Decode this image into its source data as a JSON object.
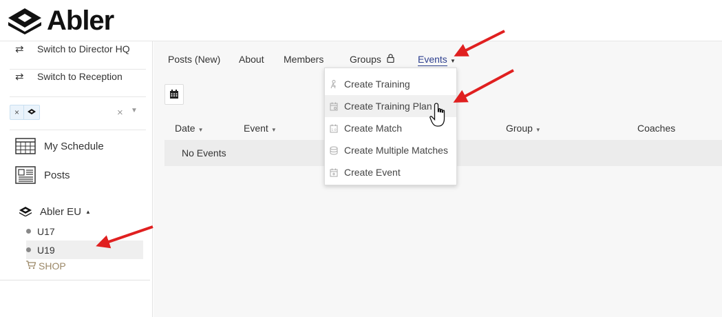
{
  "brand": {
    "name": "Abler"
  },
  "sidebar": {
    "switches": [
      {
        "label": "Switch to Director HQ"
      },
      {
        "label": "Switch to Reception"
      }
    ],
    "filter": {
      "chip_remove": "×",
      "clear": "×"
    },
    "nav": [
      {
        "label": "My Schedule",
        "icon": "calendar-grid-icon"
      },
      {
        "label": "Posts",
        "icon": "newspaper-icon"
      }
    ],
    "org": {
      "label": "Abler EU",
      "expanded": true
    },
    "teams": [
      {
        "label": "U17",
        "active": false
      },
      {
        "label": "U19",
        "active": true
      }
    ],
    "shop": {
      "label": "SHOP"
    }
  },
  "main": {
    "tabs": [
      {
        "label": "Posts (New)"
      },
      {
        "label": "About"
      },
      {
        "label": "Members"
      },
      {
        "label": "Groups"
      },
      {
        "label": "Events",
        "active": true
      }
    ],
    "table": {
      "columns": [
        {
          "label": "Date",
          "sortable": true
        },
        {
          "label": "Event",
          "sortable": true
        },
        {
          "label": "Group",
          "sortable": true
        },
        {
          "label": "Coaches",
          "sortable": false
        }
      ],
      "empty_text": "No Events"
    }
  },
  "events_menu": {
    "items": [
      {
        "label": "Create Training",
        "icon": "training-icon"
      },
      {
        "label": "Create Training Plan",
        "icon": "training-plan-icon",
        "hovered": true
      },
      {
        "label": "Create Match",
        "icon": "match-icon"
      },
      {
        "label": "Create Multiple Matches",
        "icon": "multiple-matches-icon"
      },
      {
        "label": "Create Event",
        "icon": "event-icon"
      }
    ]
  },
  "colors": {
    "active_tab": "#2d3f8f",
    "annotation_arrow": "#e02020",
    "shop": "#9b8766"
  }
}
